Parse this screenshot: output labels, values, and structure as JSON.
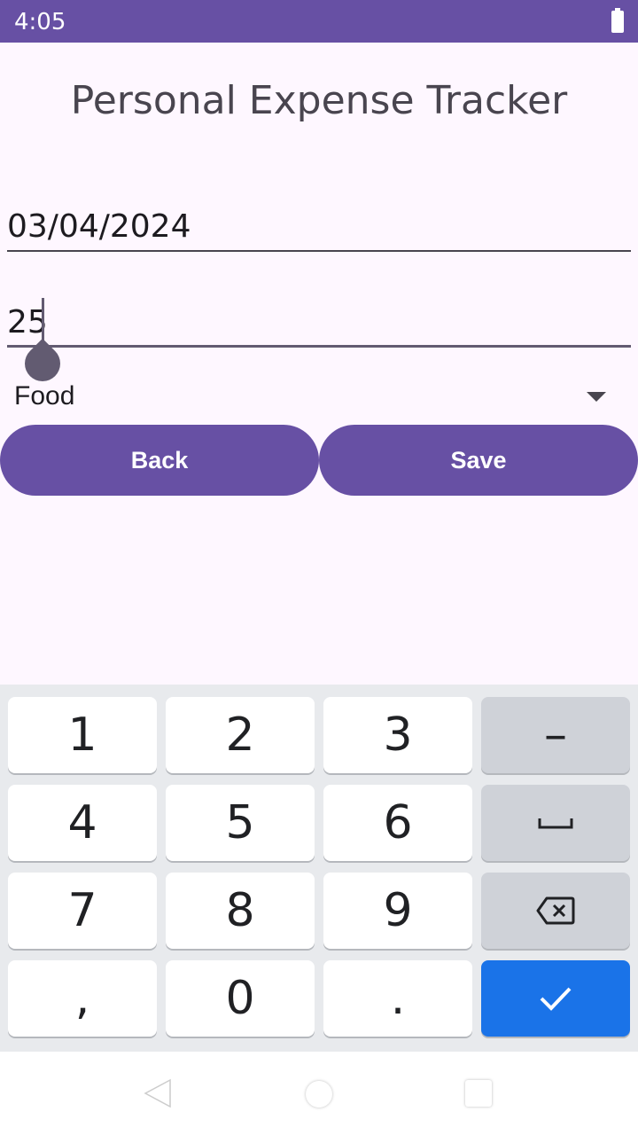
{
  "status_bar": {
    "time": "4:05",
    "battery_icon": "battery-full-icon"
  },
  "app": {
    "title": "Personal Expense Tracker"
  },
  "form": {
    "date_value": "03/04/2024",
    "amount_value": "25",
    "category_value": "Food"
  },
  "buttons": {
    "back_label": "Back",
    "save_label": "Save"
  },
  "keyboard": {
    "keys": {
      "k1": "1",
      "k2": "2",
      "k3": "3",
      "minus": "–",
      "k4": "4",
      "k5": "5",
      "k6": "6",
      "k7": "7",
      "k8": "8",
      "k9": "9",
      "comma": ",",
      "k0": "0",
      "period": "."
    },
    "space_icon": "space-icon",
    "backspace_icon": "backspace-icon",
    "done_icon": "checkmark-icon"
  },
  "nav_bar": {
    "back_icon": "nav-back-icon",
    "home_icon": "nav-home-icon",
    "recents_icon": "nav-recents-icon"
  },
  "colors": {
    "primary": "#6750a4",
    "done_key": "#1a73e8",
    "background": "#fef7ff"
  }
}
